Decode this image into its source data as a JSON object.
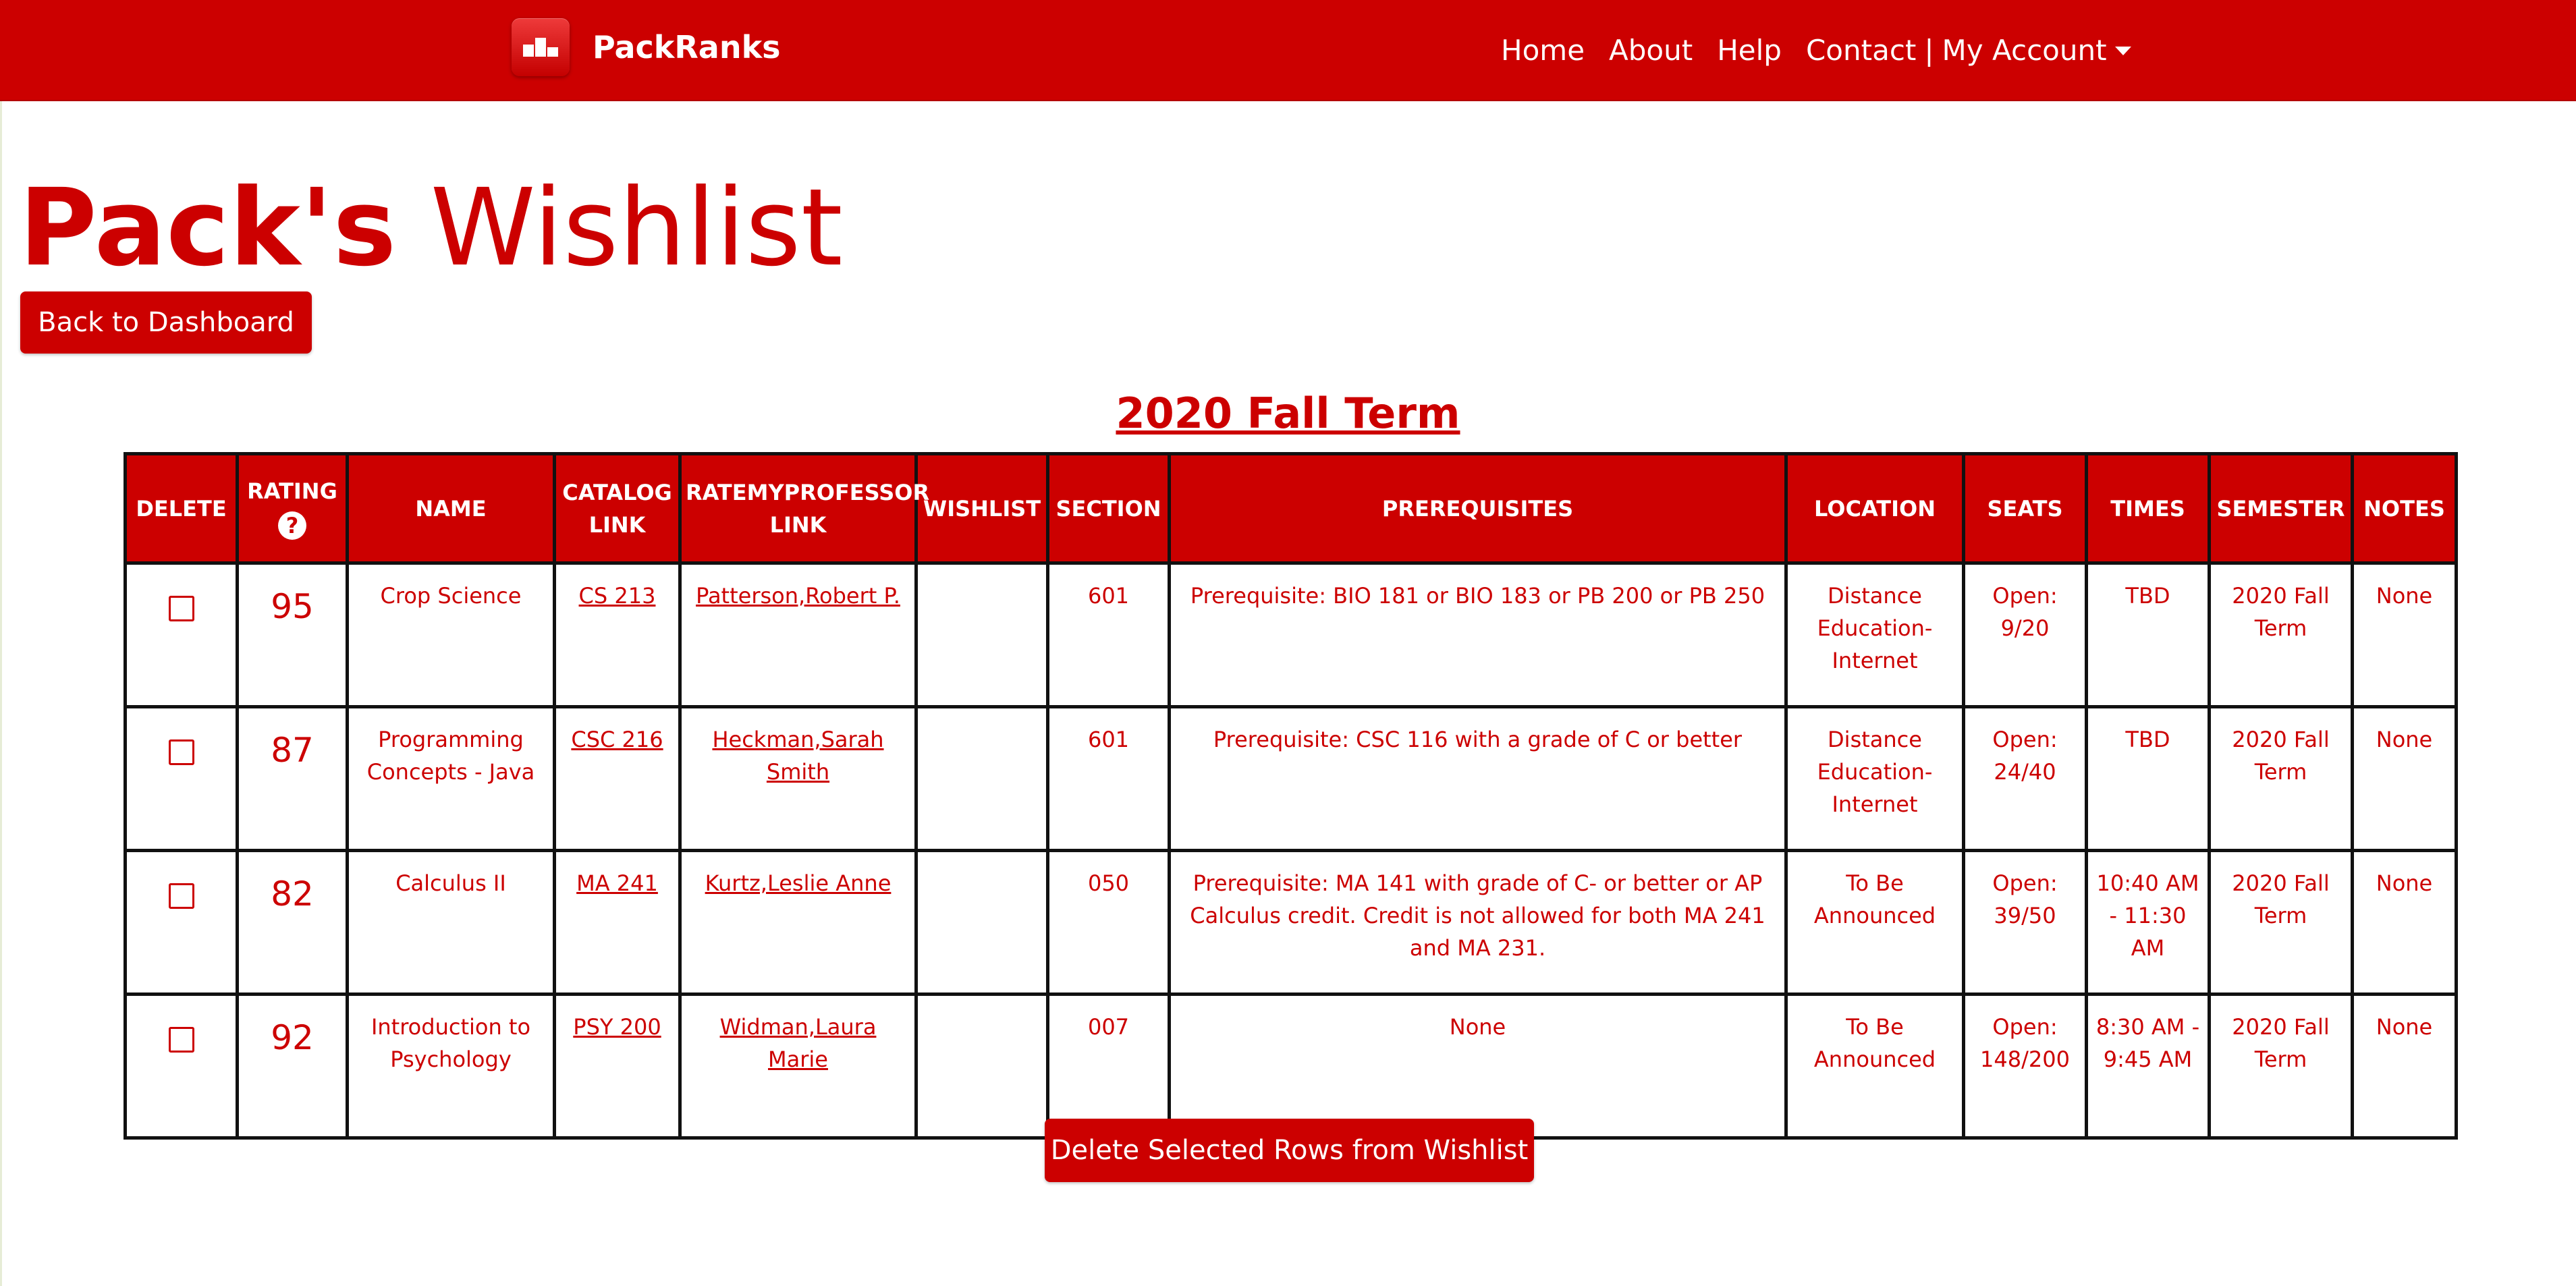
{
  "nav": {
    "brand": "PackRanks",
    "brand_icon": "podium-icon",
    "links": [
      "Home",
      "About",
      "Help",
      "Contact"
    ],
    "separator": "|",
    "account": "My Account"
  },
  "page": {
    "title_bold": "Pack's",
    "title_rest": "Wishlist",
    "back_button": "Back to Dashboard",
    "term": "2020 Fall Term",
    "delete_button": "Delete Selected Rows from Wishlist"
  },
  "table": {
    "headers": {
      "delete": "DELETE",
      "rating": "RATING",
      "rating_help": "?",
      "name": "NAME",
      "catalog": "CATALOG LINK",
      "rmp": "RATEMYPROFESSOR LINK",
      "wishlist": "WISHLIST",
      "section": "SECTION",
      "prereq": "PREREQUISITES",
      "location": "LOCATION",
      "seats": "SEATS",
      "times": "TIMES",
      "semester": "SEMESTER",
      "notes": "NOTES"
    },
    "rows": [
      {
        "rating": "95",
        "name": "Crop Science",
        "catalog": "CS 213",
        "professor": "Patterson,Robert P.",
        "wishlist": "",
        "section": "601",
        "prereq": "Prerequisite: BIO 181 or BIO 183 or PB 200 or PB 250",
        "location": "Distance Education-Internet",
        "seats": "Open: 9/20",
        "times": "TBD",
        "semester": "2020 Fall Term",
        "notes": "None"
      },
      {
        "rating": "87",
        "name": "Programming Concepts - Java",
        "catalog": "CSC 216",
        "professor": "Heckman,Sarah Smith",
        "wishlist": "",
        "section": "601",
        "prereq": "Prerequisite: CSC 116 with a grade of C or better",
        "location": "Distance Education-Internet",
        "seats": "Open: 24/40",
        "times": "TBD",
        "semester": "2020 Fall Term",
        "notes": "None"
      },
      {
        "rating": "82",
        "name": "Calculus II",
        "catalog": "MA 241",
        "professor": "Kurtz,Leslie Anne",
        "wishlist": "",
        "section": "050",
        "prereq": "Prerequisite: MA 141 with grade of C- or better or AP Calculus credit. Credit is not allowed for both MA 241 and MA 231.",
        "location": "To Be Announced",
        "seats": "Open: 39/50",
        "times": "10:40 AM - 11:30 AM",
        "semester": "2020 Fall Term",
        "notes": "None"
      },
      {
        "rating": "92",
        "name": "Introduction to Psychology",
        "catalog": "PSY 200",
        "professor": "Widman,Laura Marie",
        "wishlist": "",
        "section": "007",
        "prereq": "None",
        "location": "To Be Announced",
        "seats": "Open: 148/200",
        "times": "8:30 AM - 9:45 AM",
        "semester": "2020 Fall Term",
        "notes": "None"
      }
    ]
  },
  "colors": {
    "brand_red": "#cc0000",
    "table_border": "#111111",
    "background": "#ffffff"
  }
}
